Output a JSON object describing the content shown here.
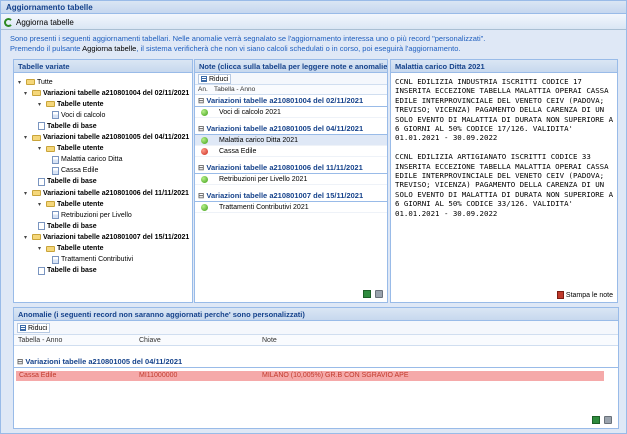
{
  "window": {
    "title": "Aggiornamento tabelle"
  },
  "toolbar": {
    "refresh_label": "Aggiorna tabelle"
  },
  "info": {
    "line1": "Sono presenti i seguenti aggiornamenti tabellari. Nelle anomalie verrà segnalato se l'aggiornamento interessa uno o più record \"personalizzati\".",
    "line2_pre": "Premendo il pulsante ",
    "line2_btn": "Aggiorna tabelle",
    "line2_post": ", il sistema verificherà che non vi siano calcoli schedulati o in corso, poi eseguirà l'aggiornamento."
  },
  "tree_panel": {
    "title": "Tabelle variate",
    "nodes": [
      {
        "label": "Tutte",
        "type": "folder",
        "level": 0,
        "bold": false
      },
      {
        "label": "Variazioni tabelle a210801004 del 02/11/2021",
        "type": "folder",
        "level": 1,
        "bold": true
      },
      {
        "label": "Tabelle utente",
        "type": "folder",
        "level": 2,
        "bold": true
      },
      {
        "label": "Voci di calcolo",
        "type": "leaf",
        "level": 3,
        "bold": false
      },
      {
        "label": "Tabelle di base",
        "type": "leaf",
        "level": 2,
        "bold": true
      },
      {
        "label": "Variazioni tabelle a210801005 del 04/11/2021",
        "type": "folder",
        "level": 1,
        "bold": true
      },
      {
        "label": "Tabelle utente",
        "type": "folder",
        "level": 2,
        "bold": true
      },
      {
        "label": "Malattia carico Ditta",
        "type": "leaf",
        "level": 3,
        "bold": false
      },
      {
        "label": "Cassa Edile",
        "type": "leaf",
        "level": 3,
        "bold": false
      },
      {
        "label": "Tabelle di base",
        "type": "leaf",
        "level": 2,
        "bold": true
      },
      {
        "label": "Variazioni tabelle a210801006 del 11/11/2021",
        "type": "folder",
        "level": 1,
        "bold": true
      },
      {
        "label": "Tabelle utente",
        "type": "folder",
        "level": 2,
        "bold": true
      },
      {
        "label": "Retribuzioni per Livello",
        "type": "leaf",
        "level": 3,
        "bold": false
      },
      {
        "label": "Tabelle di base",
        "type": "leaf",
        "level": 2,
        "bold": true
      },
      {
        "label": "Variazioni tabelle a210801007 del 15/11/2021",
        "type": "folder",
        "level": 1,
        "bold": true
      },
      {
        "label": "Tabelle utente",
        "type": "folder",
        "level": 2,
        "bold": true
      },
      {
        "label": "Trattamenti Contributivi",
        "type": "leaf",
        "level": 3,
        "bold": false
      },
      {
        "label": "Tabelle di base",
        "type": "leaf",
        "level": 2,
        "bold": true
      }
    ]
  },
  "notes_panel": {
    "title": "Note (clicca sulla tabella per leggere note e anomalie)",
    "collapse_label": "Riduci",
    "col_an": "An.",
    "col_table": "Tabella - Anno",
    "groups": [
      {
        "label": "Variazioni tabelle a210801004 del 02/11/2021",
        "rows": [
          {
            "text": "Voci di calcolo 2021",
            "status": "green",
            "selected": false
          }
        ]
      },
      {
        "label": "Variazioni tabelle a210801005 del 04/11/2021",
        "rows": [
          {
            "text": "Malattia carico Ditta 2021",
            "status": "green",
            "selected": true
          },
          {
            "text": "Cassa Edile",
            "status": "red",
            "selected": false
          }
        ]
      },
      {
        "label": "Variazioni tabelle a210801006 del 11/11/2021",
        "rows": [
          {
            "text": "Retribuzioni per Livello 2021",
            "status": "green",
            "selected": false
          }
        ]
      },
      {
        "label": "Variazioni tabelle a210801007 del 15/11/2021",
        "rows": [
          {
            "text": "Trattamenti Contributivi 2021",
            "status": "green",
            "selected": false
          }
        ]
      }
    ]
  },
  "detail_panel": {
    "title": "Malattia carico Ditta 2021",
    "text": "CCNL EDILIZIA INDUSTRIA ISCRITTI CODICE 17 INSERITA ECCEZIONE TABELLA MALATTIA OPERAI CASSA EDILE INTERPROVINCIALE DEL VENETO CEIV (PADOVA; TREVISO; VICENZA) PAGAMENTO DELLA CARENZA DI UN SOLO EVENTO DI MALATTIA DI DURATA NON SUPERIORE A 6 GIORNI AL 50% CODICE 17/126. VALIDITA' 01.01.2021 - 30.09.2022\n\nCCNL EDILIZIA ARTIGIANATO ISCRITTI CODICE 33 INSERITA ECCEZIONE TABELLA MALATTIA OPERAI CASSA EDILE INTERPROVINCIALE DEL VENETO CEIV (PADOVA; TREVISO; VICENZA) PAGAMENTO DELLA CARENZA DI UN SOLO EVENTO DI MALATTIA DI DURATA NON SUPERIORE A 6 GIORNI AL 50% CODICE 33/126. VALIDITA' 01.01.2021 - 30.09.2022",
    "print_label": "Stampa le note"
  },
  "anomalies_panel": {
    "title": "Anomalie (i seguenti record non saranno aggiornati perche' sono personalizzati)",
    "collapse_label": "Riduci",
    "col_table": "Tabella - Anno",
    "col_key": "Chiave",
    "col_note": "Note",
    "group": "Variazioni tabelle a210801005 del 04/11/2021",
    "row": {
      "table": "Cassa Edile",
      "key": "MI11000000",
      "note": "MILANO (10,005%) GR.B CON SGRAVIO APE"
    }
  }
}
